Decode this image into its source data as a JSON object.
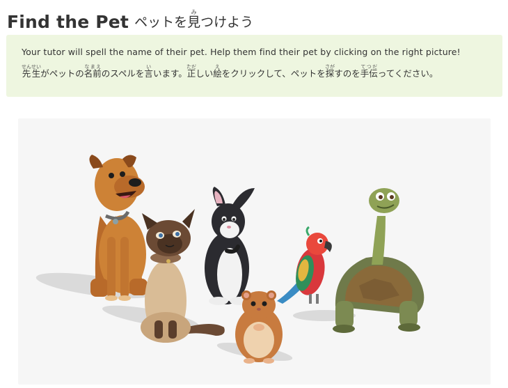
{
  "header": {
    "title_en": "Find the Pet",
    "title_ja_before": "ペットを",
    "title_ja_kanji": "見",
    "title_ja_kanji_reading": "み",
    "title_ja_after": "つけよう"
  },
  "instructions": {
    "english": "Your tutor will spell the name of their pet. Help them find their pet by clicking on the right picture!",
    "japanese_segments": [
      {
        "text": "先生",
        "ruby": "せんせい"
      },
      {
        "text": "がペットの"
      },
      {
        "text": "名前",
        "ruby": "なまえ"
      },
      {
        "text": "のスペルを"
      },
      {
        "text": "言",
        "ruby": "い"
      },
      {
        "text": "います。"
      },
      {
        "text": "正",
        "ruby": "ただ"
      },
      {
        "text": "しい"
      },
      {
        "text": "絵",
        "ruby": "え"
      },
      {
        "text": "をクリックして、ペットを"
      },
      {
        "text": "探",
        "ruby": "さが"
      },
      {
        "text": "すのを"
      },
      {
        "text": "手伝",
        "ruby": "てつだ"
      },
      {
        "text": "ってください。"
      }
    ]
  },
  "picture": {
    "pets": [
      "dog",
      "cat",
      "rabbit",
      "hamster",
      "parrot",
      "tortoise"
    ],
    "background_color": "#f6f6f6",
    "panel_color": "#eef6e0"
  }
}
